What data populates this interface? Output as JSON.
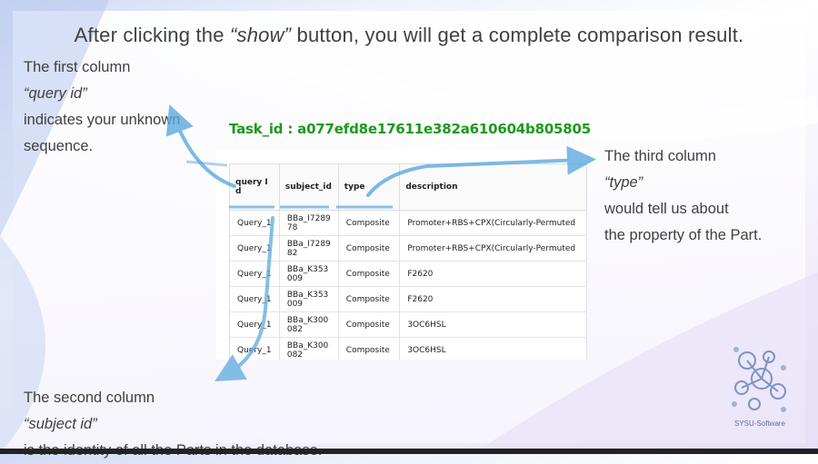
{
  "title": {
    "before": "After clicking the ",
    "emph": "“show”",
    "after": " button, you will get a complete comparison result."
  },
  "note_query": {
    "l1_before": "The first column ",
    "l1_emph": "“query id”",
    "l2": "indicates your unknown",
    "l3": "sequence."
  },
  "note_type": {
    "l1_before": "The third column ",
    "l1_emph": "“type”",
    "l2": "would tell us about",
    "l3": "the property of the Part."
  },
  "note_subject": {
    "l1_before": "The second column ",
    "l1_emph": "“subject id”",
    "l2": "is the identity of all the Parts in the database."
  },
  "task_id": "Task_id : a077efd8e17611e382a610604b805805",
  "table": {
    "headers": [
      "query I d",
      "subject_id",
      "type",
      "description"
    ],
    "rows": [
      [
        "Query_1",
        "BBa_I7289 78",
        "Composite",
        "Promoter+RBS+CPX(Circularly-Permuted"
      ],
      [
        "Query_1",
        "BBa_I7289 82",
        "Composite",
        "Promoter+RBS+CPX(Circularly-Permuted"
      ],
      [
        "Query_1",
        "BBa_K353 009",
        "Composite",
        "F2620"
      ],
      [
        "Query_1",
        "BBa_K353 009",
        "Composite",
        "F2620"
      ],
      [
        "Query_1",
        "BBa_K300 082",
        "Composite",
        "3OC6HSL"
      ],
      [
        "Query_1",
        "BBa_K300 082",
        "Composite",
        "3OC6HSL"
      ]
    ]
  },
  "logo_text": "SYSU-Software",
  "colors": {
    "accent_blue": "#5da9e0",
    "task_green": "#1c9a1c",
    "text": "#404040"
  }
}
